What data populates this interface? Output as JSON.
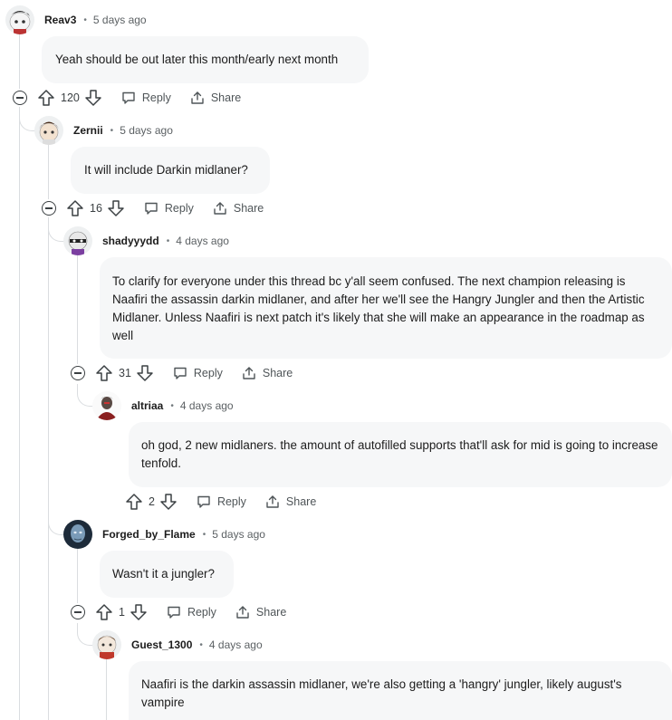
{
  "comments": [
    {
      "username": "Reav3",
      "time": "5 days ago",
      "body": "Yeah should be out later this month/early next month",
      "votes": "120",
      "avatar_icon": "snoo-avatar-dark-hair-icon"
    },
    {
      "username": "Zernii",
      "time": "5 days ago",
      "body": "It will include Darkin midlaner?",
      "votes": "16",
      "avatar_icon": "snoo-avatar-brown-hair-icon"
    },
    {
      "username": "shadyyydd",
      "time": "4 days ago",
      "body": "To clarify for everyone under this thread bc y'all seem confused. The next champion releasing is Naafiri the assassin darkin midlaner, and after her we'll see the Hangry Jungler and then the Artistic Midlaner. Unless Naafiri is next patch it's likely that she will make an appearance in the roadmap as well",
      "votes": "31",
      "avatar_icon": "snoo-avatar-mask-icon"
    },
    {
      "username": "altriaa",
      "time": "4 days ago",
      "body": "oh god, 2 new midlaners. the amount of autofilled supports that'll ask for mid is going to increase tenfold.",
      "votes": "2",
      "avatar_icon": "character-avatar-dark-icon"
    },
    {
      "username": "Forged_by_Flame",
      "time": "5 days ago",
      "body": "Wasn't it a jungler?",
      "votes": "1",
      "avatar_icon": "character-avatar-blue-face-icon"
    },
    {
      "username": "Guest_1300",
      "time": "4 days ago",
      "body": "Naafiri is the darkin assassin midlaner, we're also getting a 'hangry' jungler, likely august's vampire",
      "avatar_icon": "snoo-avatar-red-scarf-icon"
    }
  ],
  "labels": {
    "reply": "Reply",
    "share": "Share"
  },
  "colors": {
    "bubble": "#f6f7f8",
    "thread_line": "#dadde0",
    "text": "#1c1c1c",
    "meta": "#5c6164"
  }
}
